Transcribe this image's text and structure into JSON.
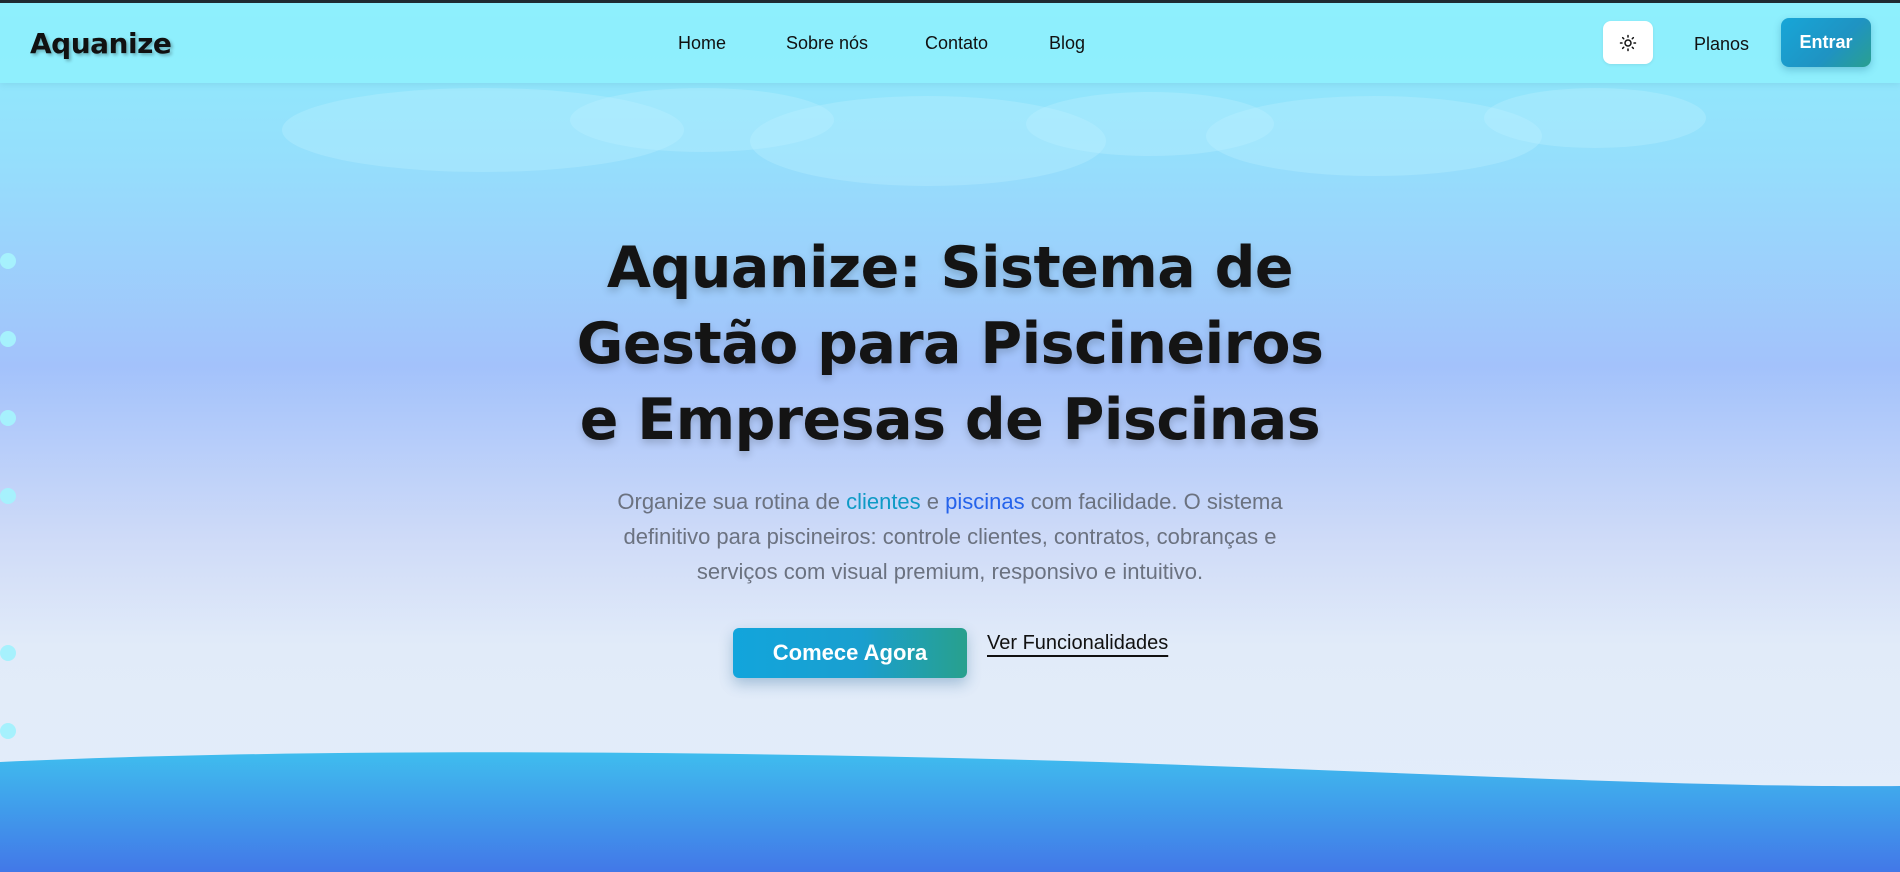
{
  "header": {
    "logo": "Aquanize",
    "nav": [
      "Home",
      "Sobre nós",
      "Contato",
      "Blog"
    ],
    "theme_toggle_icon": "sun-icon",
    "planos_label": "Planos",
    "entrar_label": "Entrar"
  },
  "hero": {
    "title": "Aquanize: Sistema de Gestão para Piscineiros e Empresas de Piscinas",
    "subtitle_part1": "Organize sua rotina de ",
    "subtitle_highlight1": "clientes",
    "subtitle_part2": " e ",
    "subtitle_highlight2": "piscinas",
    "subtitle_part3": " com facilidade. O sistema definitivo para piscineiros: controle clientes, contratos, cobranças e serviços com visual premium, responsivo e intuitivo.",
    "cta_primary": "Comece Agora",
    "cta_secondary": "Ver Funcionalidades"
  },
  "colors": {
    "accent_cyan": "#0e9ac6",
    "accent_blue": "#2563eb",
    "button_gradient_start": "#12a5dc",
    "button_gradient_end": "#28a08d",
    "wave_top": "#3fbdee",
    "wave_bottom": "#4278e8"
  }
}
